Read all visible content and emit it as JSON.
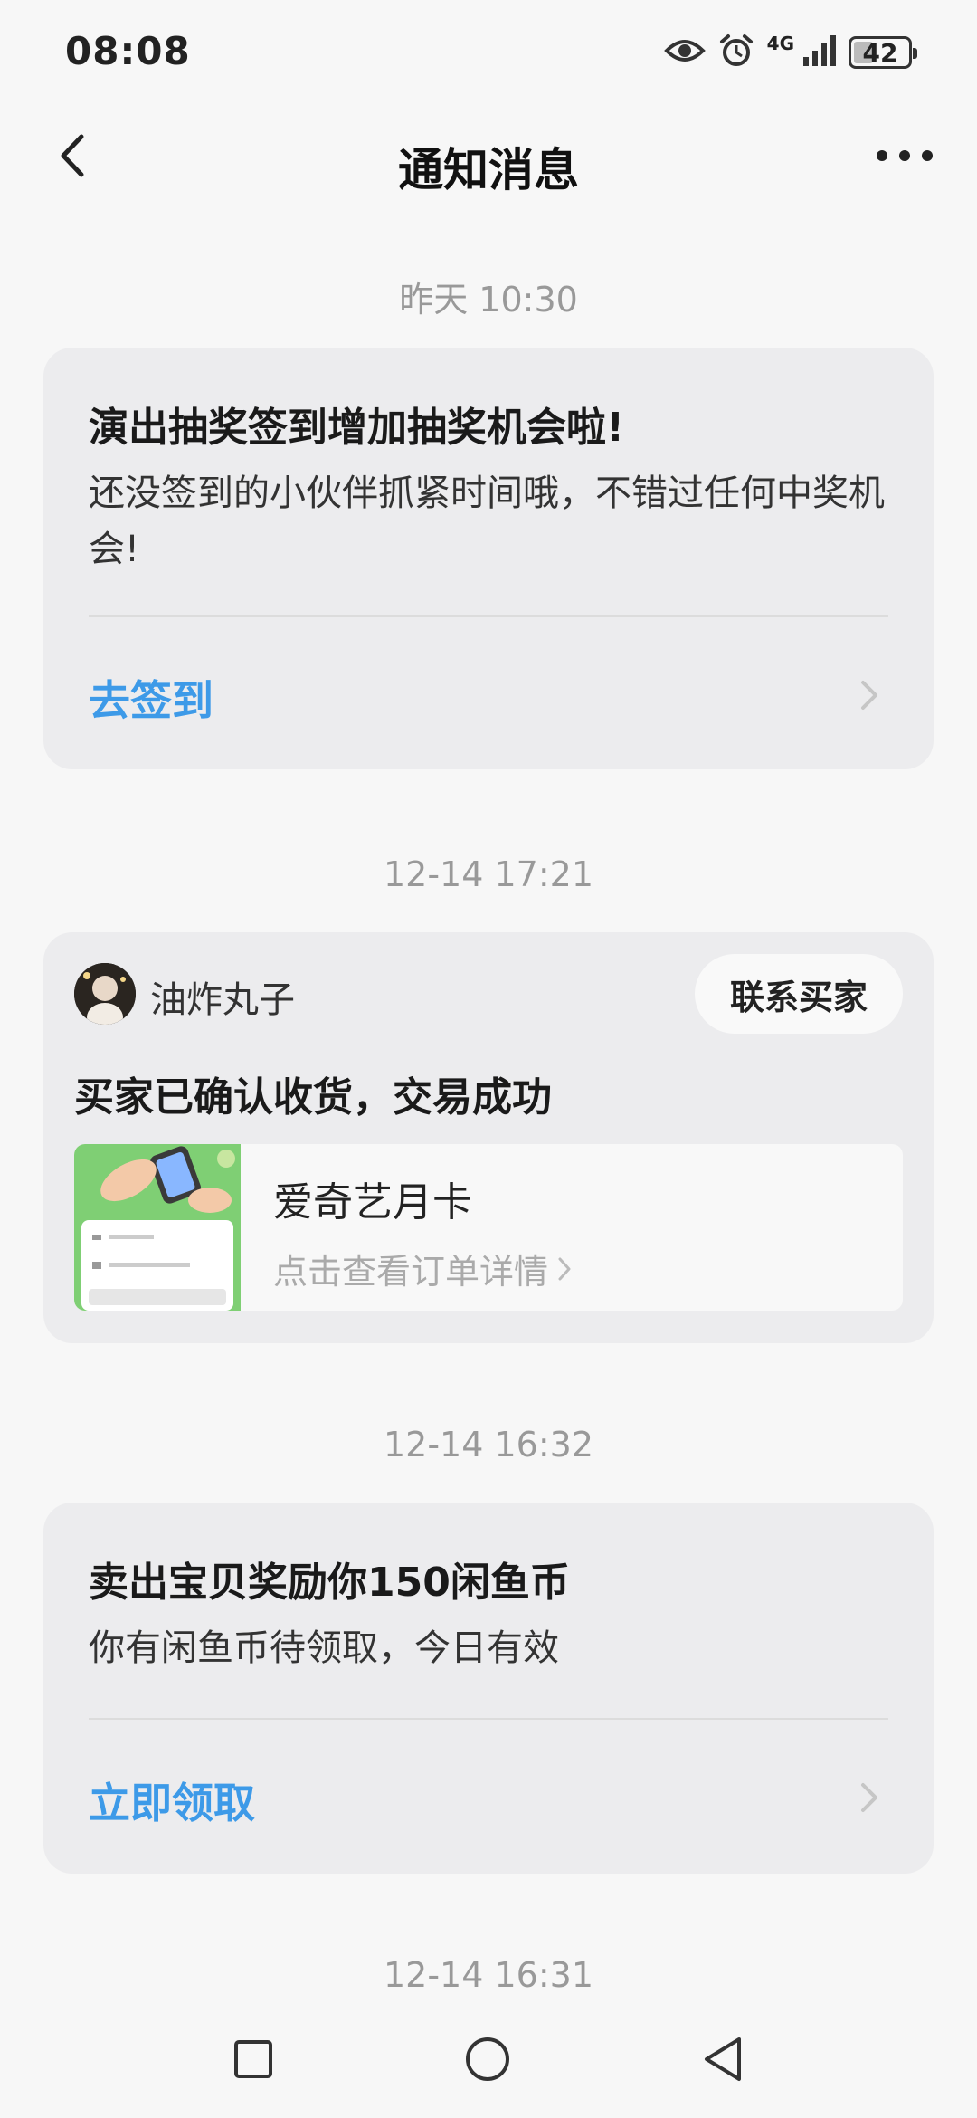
{
  "status_bar": {
    "time": "08:08",
    "network": "4G",
    "battery": "42",
    "battery_level": 0.42,
    "icons": [
      "eye-icon",
      "alarm-icon",
      "signal-icon",
      "battery-icon"
    ]
  },
  "header": {
    "title": "通知消息",
    "back_icon": "chevron-left-icon",
    "more_icon": "more-dots-icon"
  },
  "notifications": [
    {
      "timestamp": "昨天 10:30",
      "title": "演出抽奖签到增加抽奖机会啦!",
      "body": "还没签到的小伙伴抓紧时间哦，不错过任何中奖机会!",
      "action": "去签到"
    },
    {
      "timestamp": "12-14 17:21",
      "seller_name": "油炸丸子",
      "contact_label": "联系买家",
      "status": "买家已确认收货，交易成功",
      "product_name": "爱奇艺月卡",
      "product_link": "点击查看订单详情"
    },
    {
      "timestamp": "12-14 16:32",
      "title": "卖出宝贝奖励你150闲鱼币",
      "body": "你有闲鱼币待领取，今日有效",
      "action": "立即领取"
    },
    {
      "timestamp": "12-14 16:31"
    }
  ],
  "colors": {
    "accent": "#3d9ae8",
    "background": "#f7f7f7",
    "card": "#ececee",
    "timestamp": "#999999"
  },
  "system_nav": [
    "recent-apps-icon",
    "home-icon",
    "back-triangle-icon"
  ]
}
